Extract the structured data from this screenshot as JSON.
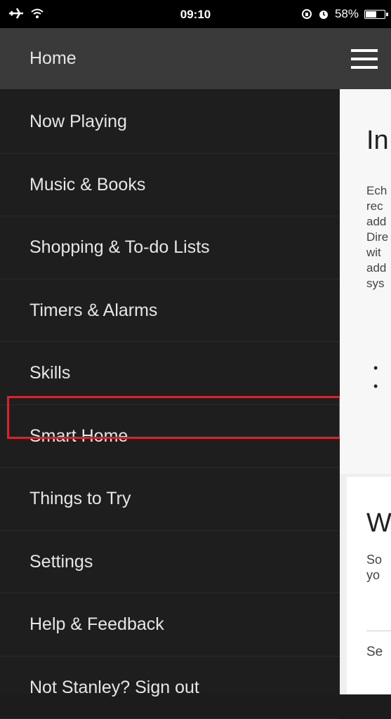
{
  "status": {
    "time": "09:10",
    "battery": "58%",
    "battery_level": 0.58
  },
  "drawer": {
    "items": [
      {
        "label": "Home"
      },
      {
        "label": "Now Playing"
      },
      {
        "label": "Music & Books"
      },
      {
        "label": "Shopping & To-do Lists"
      },
      {
        "label": "Timers & Alarms"
      },
      {
        "label": "Skills"
      },
      {
        "label": "Smart Home"
      },
      {
        "label": "Things to Try"
      },
      {
        "label": "Settings"
      },
      {
        "label": "Help & Feedback"
      },
      {
        "label": "Not Stanley? Sign out"
      }
    ],
    "highlighted": "Smart Home"
  },
  "content": {
    "card1_title": "In",
    "card1_text": "Ech\nrec\nadd\nDire\nwit\nadd\nsys",
    "card2_title": "W",
    "card2_text": "So\nyo",
    "card2_link": "Se"
  },
  "colors": {
    "highlight_border": "#e0202a",
    "drawer_bg": "#1e1e1e",
    "home_bg": "#3a3a3a"
  }
}
